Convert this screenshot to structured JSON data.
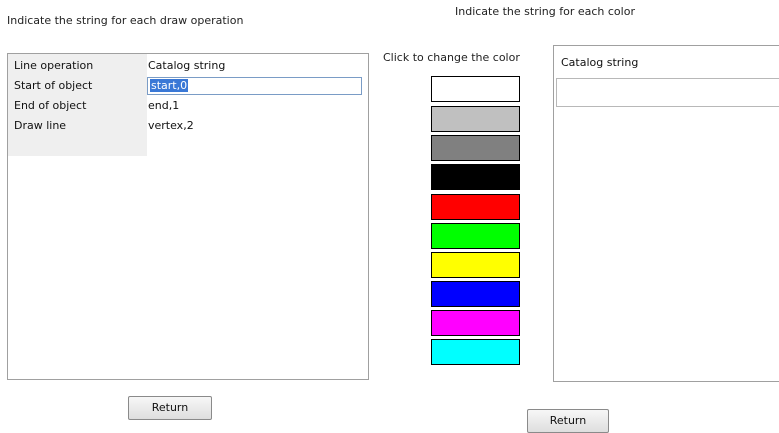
{
  "draw_panel": {
    "title": "Indicate the string for each draw operation",
    "header_op": "Line operation",
    "header_string": "Catalog string",
    "rows": [
      {
        "op": "Start of object",
        "value": "start,0",
        "selected": true
      },
      {
        "op": "End of object",
        "value": "end,1"
      },
      {
        "op": "Draw line",
        "value": "vertex,2"
      }
    ],
    "return_label": "Return"
  },
  "color_panel": {
    "title": "Indicate the string for each color",
    "change_label": "Click to change the color",
    "header_string": "Catalog string",
    "colors": [
      "#ffffff",
      "#c0c0c0",
      "#808080",
      "#000000",
      "#ff0000",
      "#00ff00",
      "#ffff00",
      "#0000ff",
      "#ff00ff",
      "#00ffff"
    ],
    "return_label": "Return"
  }
}
